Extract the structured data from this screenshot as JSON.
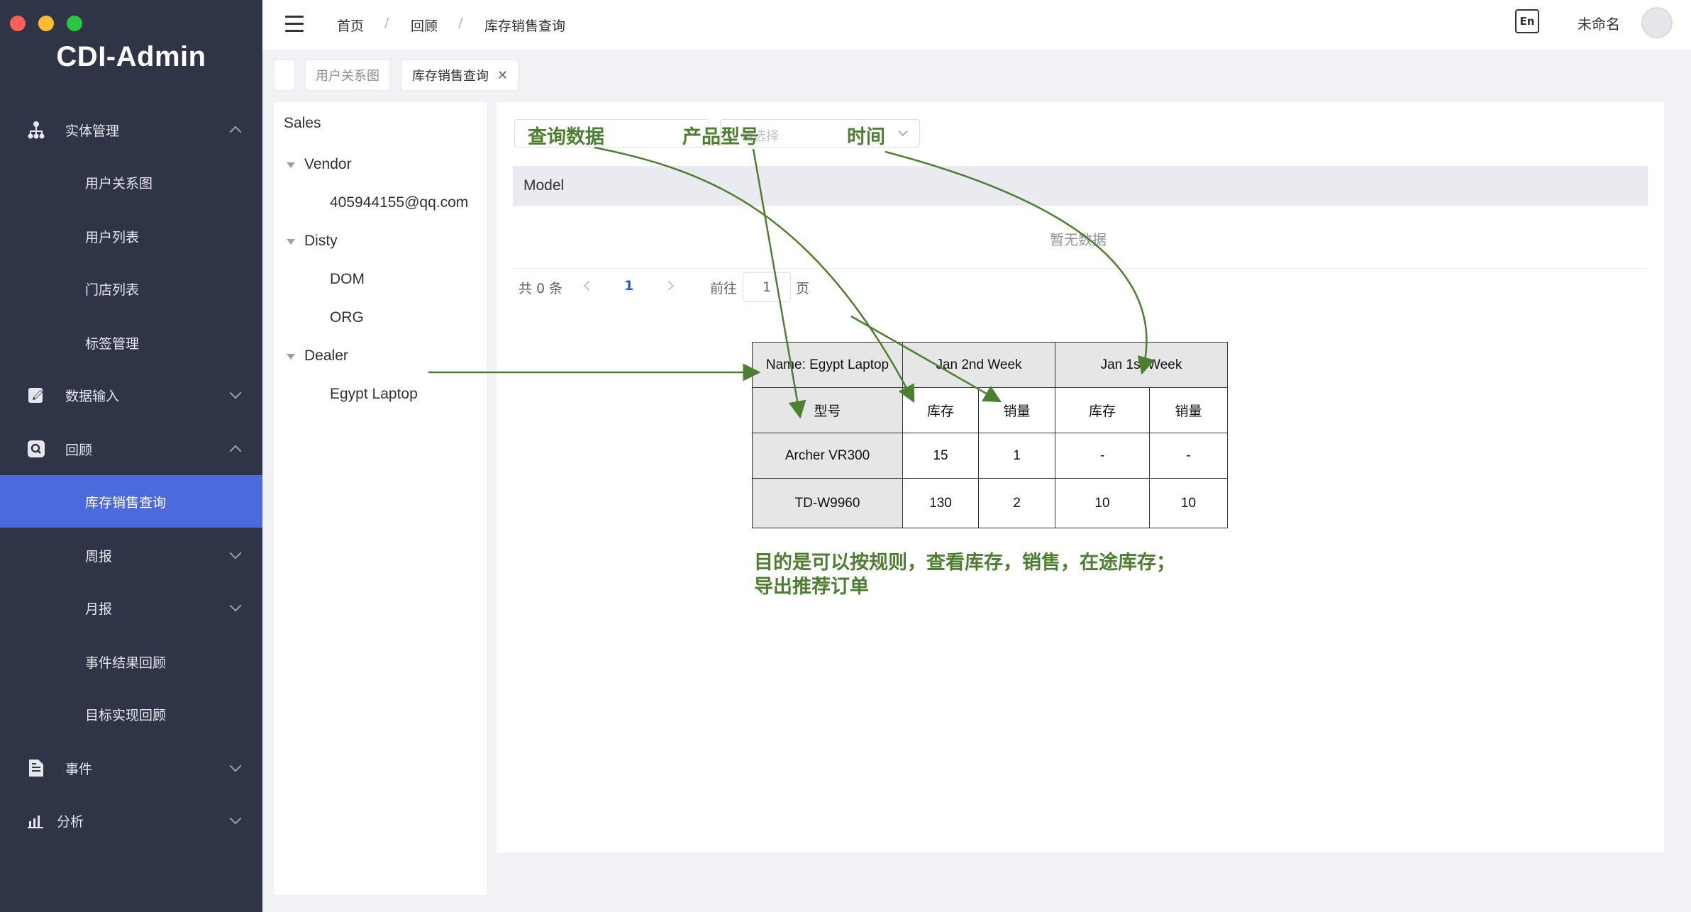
{
  "app": {
    "brand": "CDI-Admin"
  },
  "sidebar": {
    "items": [
      {
        "label": "实体管理",
        "icon": "org-tree-icon",
        "expanded": true
      },
      {
        "label": "用户关系图"
      },
      {
        "label": "用户列表"
      },
      {
        "label": "门店列表"
      },
      {
        "label": "标签管理"
      },
      {
        "label": "数据输入",
        "icon": "edit-icon",
        "expanded": false
      },
      {
        "label": "回顾",
        "icon": "search-icon",
        "expanded": true
      },
      {
        "label": "库存销售查询",
        "active": true
      },
      {
        "label": "周报",
        "expanded": false
      },
      {
        "label": "月报",
        "expanded": false
      },
      {
        "label": "事件结果回顾"
      },
      {
        "label": "目标实现回顾"
      },
      {
        "label": "事件",
        "icon": "document-icon",
        "expanded": false
      },
      {
        "label": "分析",
        "icon": "bar-chart-icon",
        "expanded": false
      }
    ]
  },
  "header": {
    "breadcrumb": [
      "首页",
      "回顾",
      "库存销售查询"
    ],
    "separator": "/",
    "lang_icon": "En",
    "username": "未命名"
  },
  "tags": [
    {
      "label": "用户关系图"
    },
    {
      "label": "库存销售查询",
      "active": true
    }
  ],
  "tree": {
    "root": "Sales",
    "nodes": [
      {
        "label": "Vendor",
        "children": [
          "405944155@qq.com"
        ]
      },
      {
        "label": "Disty",
        "children": [
          "DOM",
          "ORG"
        ]
      },
      {
        "label": "Dealer",
        "children": [
          "Egypt Laptop"
        ]
      }
    ]
  },
  "filters": {
    "placeholder": "请选择"
  },
  "table": {
    "column": "Model",
    "empty_text": "暂无数据"
  },
  "pagination": {
    "total": "共 0 条",
    "current_page": "1",
    "goto_label": "前往",
    "goto_value": "1",
    "page_suffix": "页"
  },
  "annotations": {
    "query_data": "查询数据",
    "product_model": "产品型号",
    "time": "时间",
    "goal_line1": "目的是可以按规则，查看库存，销售，在途库存；",
    "goal_line2": "导出推荐订单",
    "color": "#4d7f30"
  },
  "mock_table": {
    "name_cell": "Name: Egypt Laptop",
    "week1": "Jan 2nd Week",
    "week2": "Jan 1st Week",
    "model_header": "型号",
    "stock": "库存",
    "sales": "销量",
    "rows": [
      {
        "model": "Archer VR300",
        "w1_stock": "15",
        "w1_sales": "1",
        "w2_stock": "-",
        "w2_sales": "-"
      },
      {
        "model": "TD-W9960",
        "w1_stock": "130",
        "w1_sales": "2",
        "w2_stock": "10",
        "w2_sales": "10"
      }
    ]
  },
  "colors": {
    "sidebar_bg": "#2f3447",
    "active_item": "#4b6bdd",
    "pager_active": "#1f5fd6"
  }
}
